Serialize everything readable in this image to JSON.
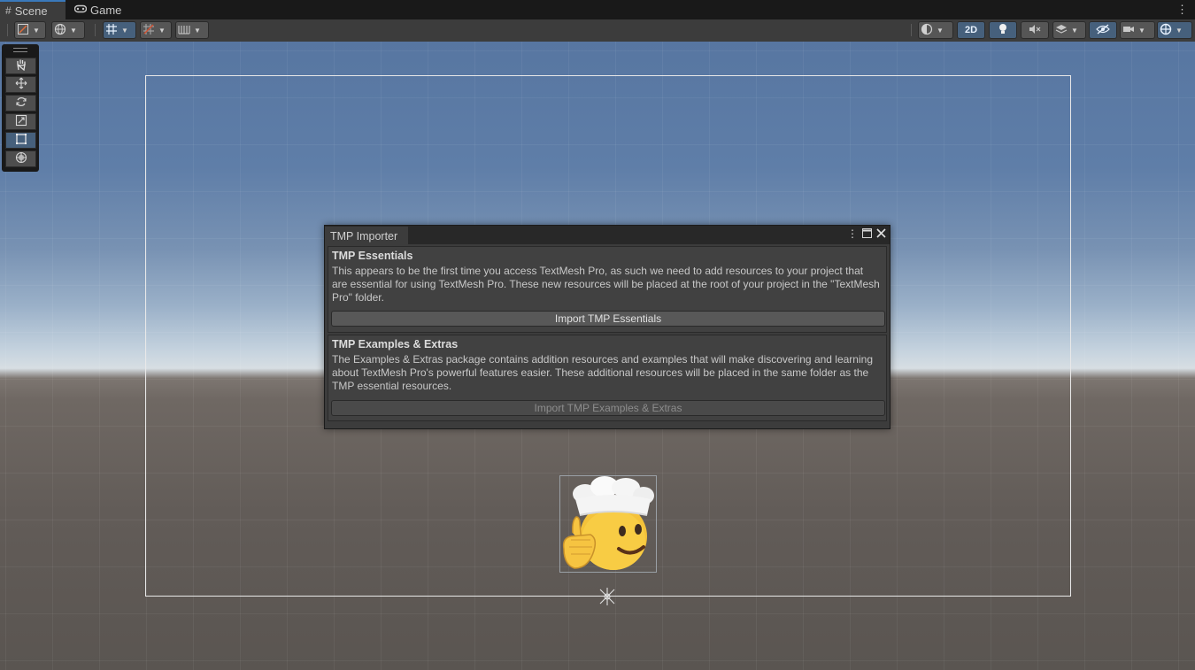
{
  "tabs": {
    "scene": {
      "label": "Scene",
      "icon": "hash-grid-icon"
    },
    "game": {
      "label": "Game",
      "icon": "gamepad-icon"
    }
  },
  "toolbar": {
    "mode_2d_label": "2D",
    "active_color": "#46607c"
  },
  "tools": [
    "hand-tool",
    "move-tool",
    "rotate-tool",
    "scale-tool",
    "rect-tool",
    "transform-tool"
  ],
  "active_tool": "rect-tool",
  "dialog": {
    "title": "TMP Importer",
    "essentials": {
      "title": "TMP Essentials",
      "body": "This appears to be the first time you access TextMesh Pro, as such we need to add resources to your project that are essential for using TextMesh Pro. These new resources will be placed at the root of your project in the \"TextMesh Pro\" folder.",
      "button": "Import TMP Essentials"
    },
    "extras": {
      "title": "TMP Examples & Extras",
      "body": "The Examples & Extras package contains addition resources and examples that will make discovering and learning about TextMesh Pro's powerful features easier. These additional resources will be placed in the same folder as the TMP essential resources.",
      "button": "Import TMP Examples & Extras"
    }
  },
  "colors": {
    "selection_blue": "#3a79bb",
    "sky_top": "#5776a1",
    "ground": "#625c58"
  }
}
